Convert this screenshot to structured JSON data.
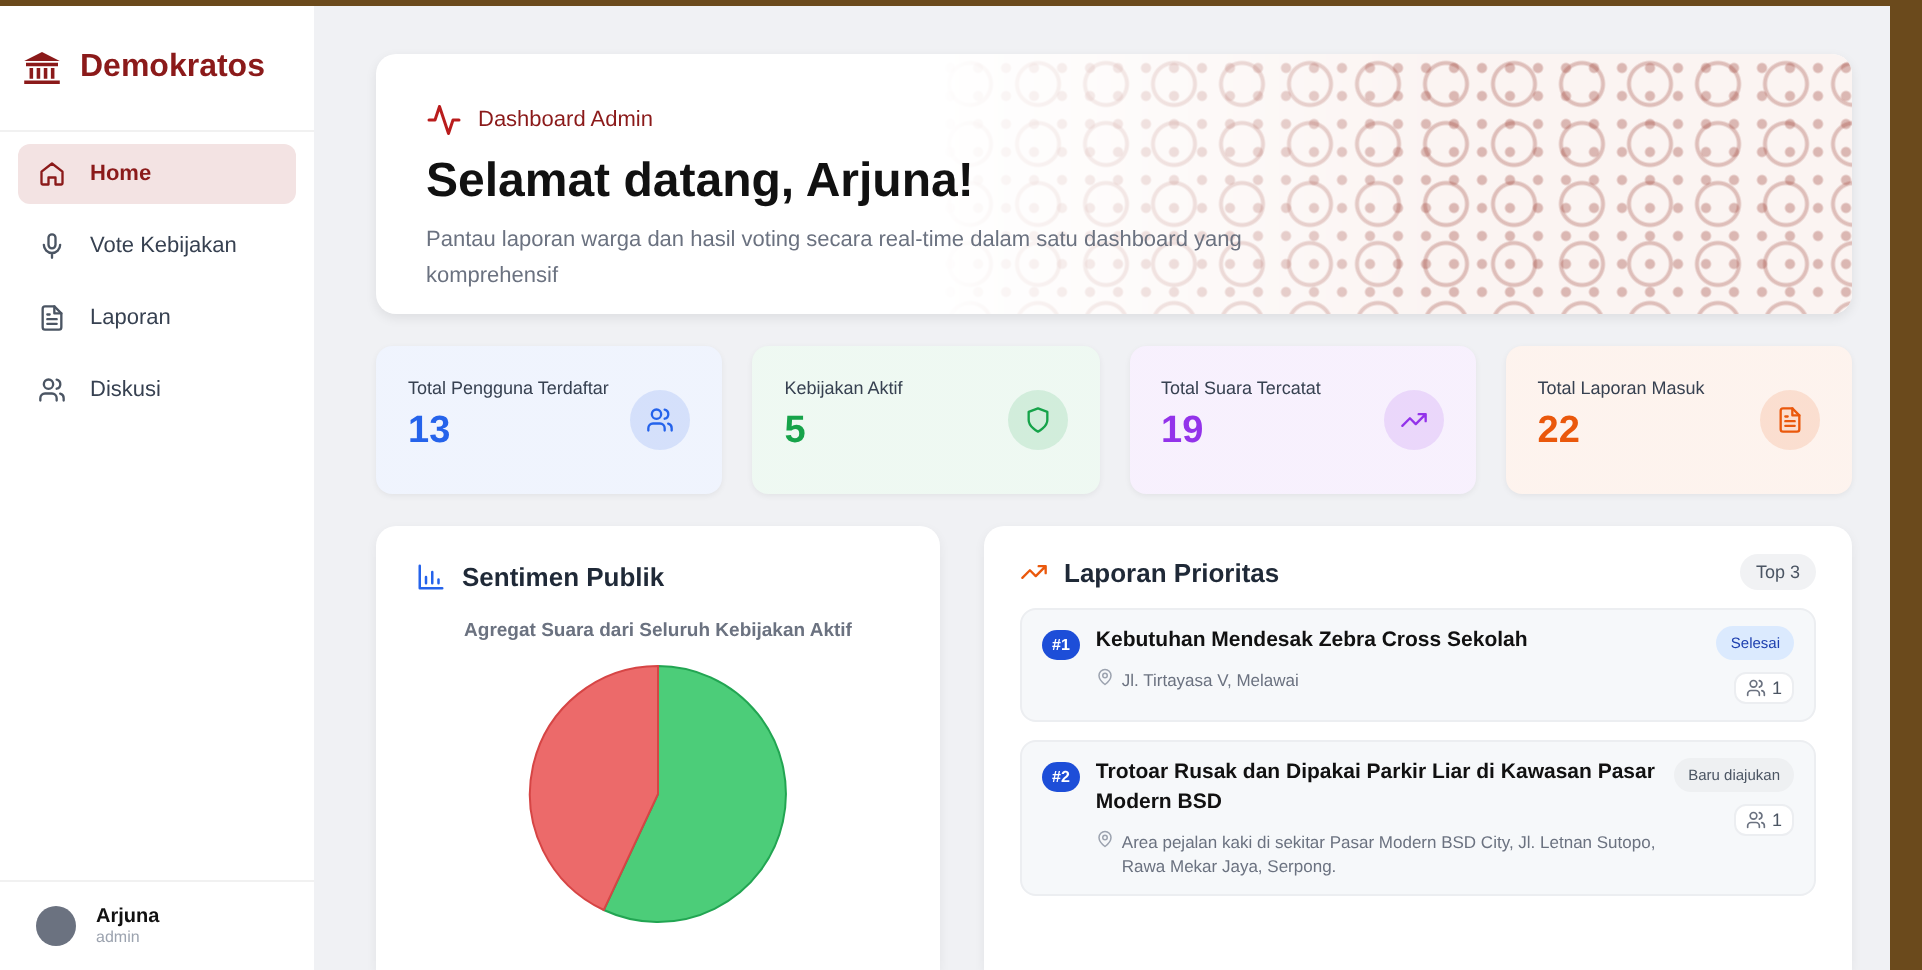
{
  "sidebar": {
    "brand": "Demokratos",
    "items": [
      {
        "label": "Home",
        "kind": "home",
        "selected": true
      },
      {
        "label": "Vote Kebijakan",
        "kind": "mic",
        "selected": false
      },
      {
        "label": "Laporan",
        "kind": "doc",
        "selected": false
      },
      {
        "label": "Diskusi",
        "kind": "users",
        "selected": false
      }
    ],
    "user": {
      "name": "Arjuna",
      "role": "admin"
    }
  },
  "hero": {
    "eyebrow": "Dashboard Admin",
    "title": "Selamat datang, Arjuna!",
    "subtitle": "Pantau laporan warga dan hasil voting secara real-time dalam satu dashboard yang komprehensif"
  },
  "stats": [
    {
      "label": "Total Pengguna Terdaftar",
      "value": "13",
      "kind": "users",
      "color": "#2563eb"
    },
    {
      "label": "Kebijakan Aktif",
      "value": "5",
      "kind": "shield",
      "color": "#16a34a"
    },
    {
      "label": "Total Suara Tercatat",
      "value": "19",
      "kind": "trend",
      "color": "#9333ea"
    },
    {
      "label": "Total Laporan Masuk",
      "value": "22",
      "kind": "doc",
      "color": "#ea580c"
    }
  ],
  "sentiment": {
    "title": "Sentimen Publik",
    "subtitle": "Agregat Suara dari Seluruh Kebijakan Aktif"
  },
  "priority": {
    "title": "Laporan Prioritas",
    "badge": "Top 3",
    "reports": [
      {
        "rank": "#1",
        "title": "Kebutuhan Mendesak Zebra Cross Sekolah",
        "location": "Jl. Tirtayasa V, Melawai",
        "status": "Selesai",
        "kind": "done",
        "count": "1"
      },
      {
        "rank": "#2",
        "title": "Trotoar Rusak dan Dipakai Parkir Liar di Kawasan Pasar Modern BSD",
        "location": "Area pejalan kaki di sekitar Pasar Modern BSD City, Jl. Letnan Sutopo, Rawa Mekar Jaya, Serpong.",
        "status": "Baru diajukan",
        "kind": "new",
        "count": "1"
      }
    ]
  }
}
